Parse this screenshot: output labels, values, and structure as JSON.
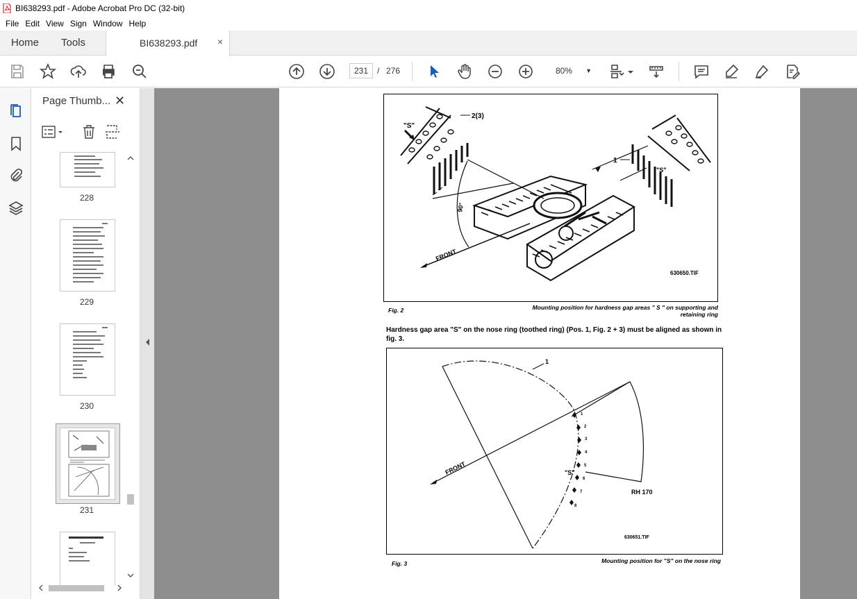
{
  "window": {
    "title": "BI638293.pdf - Adobe Acrobat Pro DC (32-bit)"
  },
  "menu": [
    "File",
    "Edit",
    "View",
    "Sign",
    "Window",
    "Help"
  ],
  "tabs": {
    "home": "Home",
    "tools": "Tools",
    "document": "BI638293.pdf",
    "close": "×"
  },
  "toolbar": {
    "current_page": "231",
    "page_separator": "/",
    "total_pages": "276",
    "zoom": "80%",
    "icons": [
      "save-icon",
      "bookmark-star-icon",
      "upload-icon",
      "print-icon",
      "zoom-search-icon",
      "page-up-icon",
      "page-down-icon",
      "select-cursor-icon",
      "hand-icon",
      "zoom-out-icon",
      "zoom-in-icon",
      "page-fit-icon",
      "scroll-mode-icon",
      "comment-icon",
      "highlight-pen-icon",
      "sign-pen-icon",
      "edit-pdf-icon"
    ]
  },
  "sidebar": {
    "panel_title": "Page Thumb...",
    "thumbnails": [
      {
        "label": "228"
      },
      {
        "label": "229"
      },
      {
        "label": "230"
      },
      {
        "label": "231",
        "selected": true
      },
      {
        "label": ""
      }
    ]
  },
  "document": {
    "fig2": {
      "label_s": "\"S\"",
      "label_23": "2(3)",
      "label_1": "1",
      "label_s2": "\"S\"",
      "label_90": "90°",
      "label_front": "FRONT",
      "tif": "630650.TIF",
      "caption_left": "Fig. 2",
      "caption_right": "Mounting position for hardness gap areas \" S \" on supporting and retaining ring"
    },
    "body": "Hardness gap area \"S\" on the nose ring (toothed ring) (Pos. 1, Fig. 2 + 3) must be aligned as shown in fig. 3.",
    "fig3": {
      "label_1": "1",
      "label_front": "FRONT",
      "label_s": "\"S\"",
      "label_rh": "RH 170",
      "tif": "630651.TIF",
      "tooth_numbers": [
        "1",
        "2",
        "3",
        "4",
        "5",
        "6",
        "7",
        "8"
      ],
      "caption_left": "Fig. 3",
      "caption_right": "Mounting position for \"S\" on the nose ring"
    }
  }
}
